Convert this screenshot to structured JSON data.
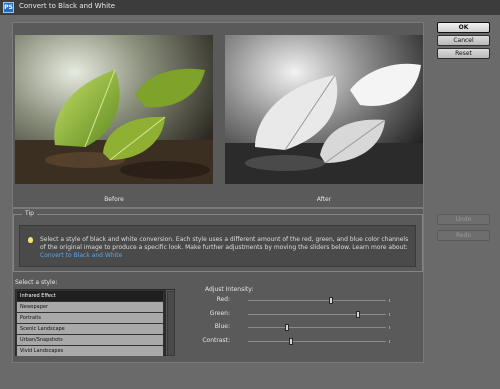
{
  "window": {
    "title": "Convert to Black and White",
    "app_icon_text": "PS"
  },
  "buttons": {
    "ok": "OK",
    "cancel": "Cancel",
    "reset": "Reset",
    "undo": "Undo",
    "redo": "Redo"
  },
  "preview": {
    "before_label": "Before",
    "after_label": "After"
  },
  "tip": {
    "label": "Tip",
    "text": "Select a style of black and white conversion. Each style uses a different amount of the red, green, and blue color channels of the original image to produce a specific look. Make further adjustments by moving the sliders below. Learn more about:",
    "link": "Convert to Black and White"
  },
  "styles": {
    "label": "Select a style:",
    "items": [
      "Infrared Effect",
      "Newspaper",
      "Portraits",
      "Scenic Landscape",
      "Urban/Snapshots",
      "Vivid Landscapes"
    ],
    "selected_index": 0
  },
  "adjust": {
    "label": "Adjust Intensity:",
    "sliders": [
      {
        "name": "Red:",
        "value": 0.6
      },
      {
        "name": "Green:",
        "value": 0.8
      },
      {
        "name": "Blue:",
        "value": 0.28
      },
      {
        "name": "Contrast:",
        "value": 0.31
      }
    ]
  },
  "colors": {
    "dialog_bg": "#5a5a5a",
    "titlebar": "#3c3c3c",
    "link": "#5aa4e8",
    "selection": "#1f1f1f"
  }
}
